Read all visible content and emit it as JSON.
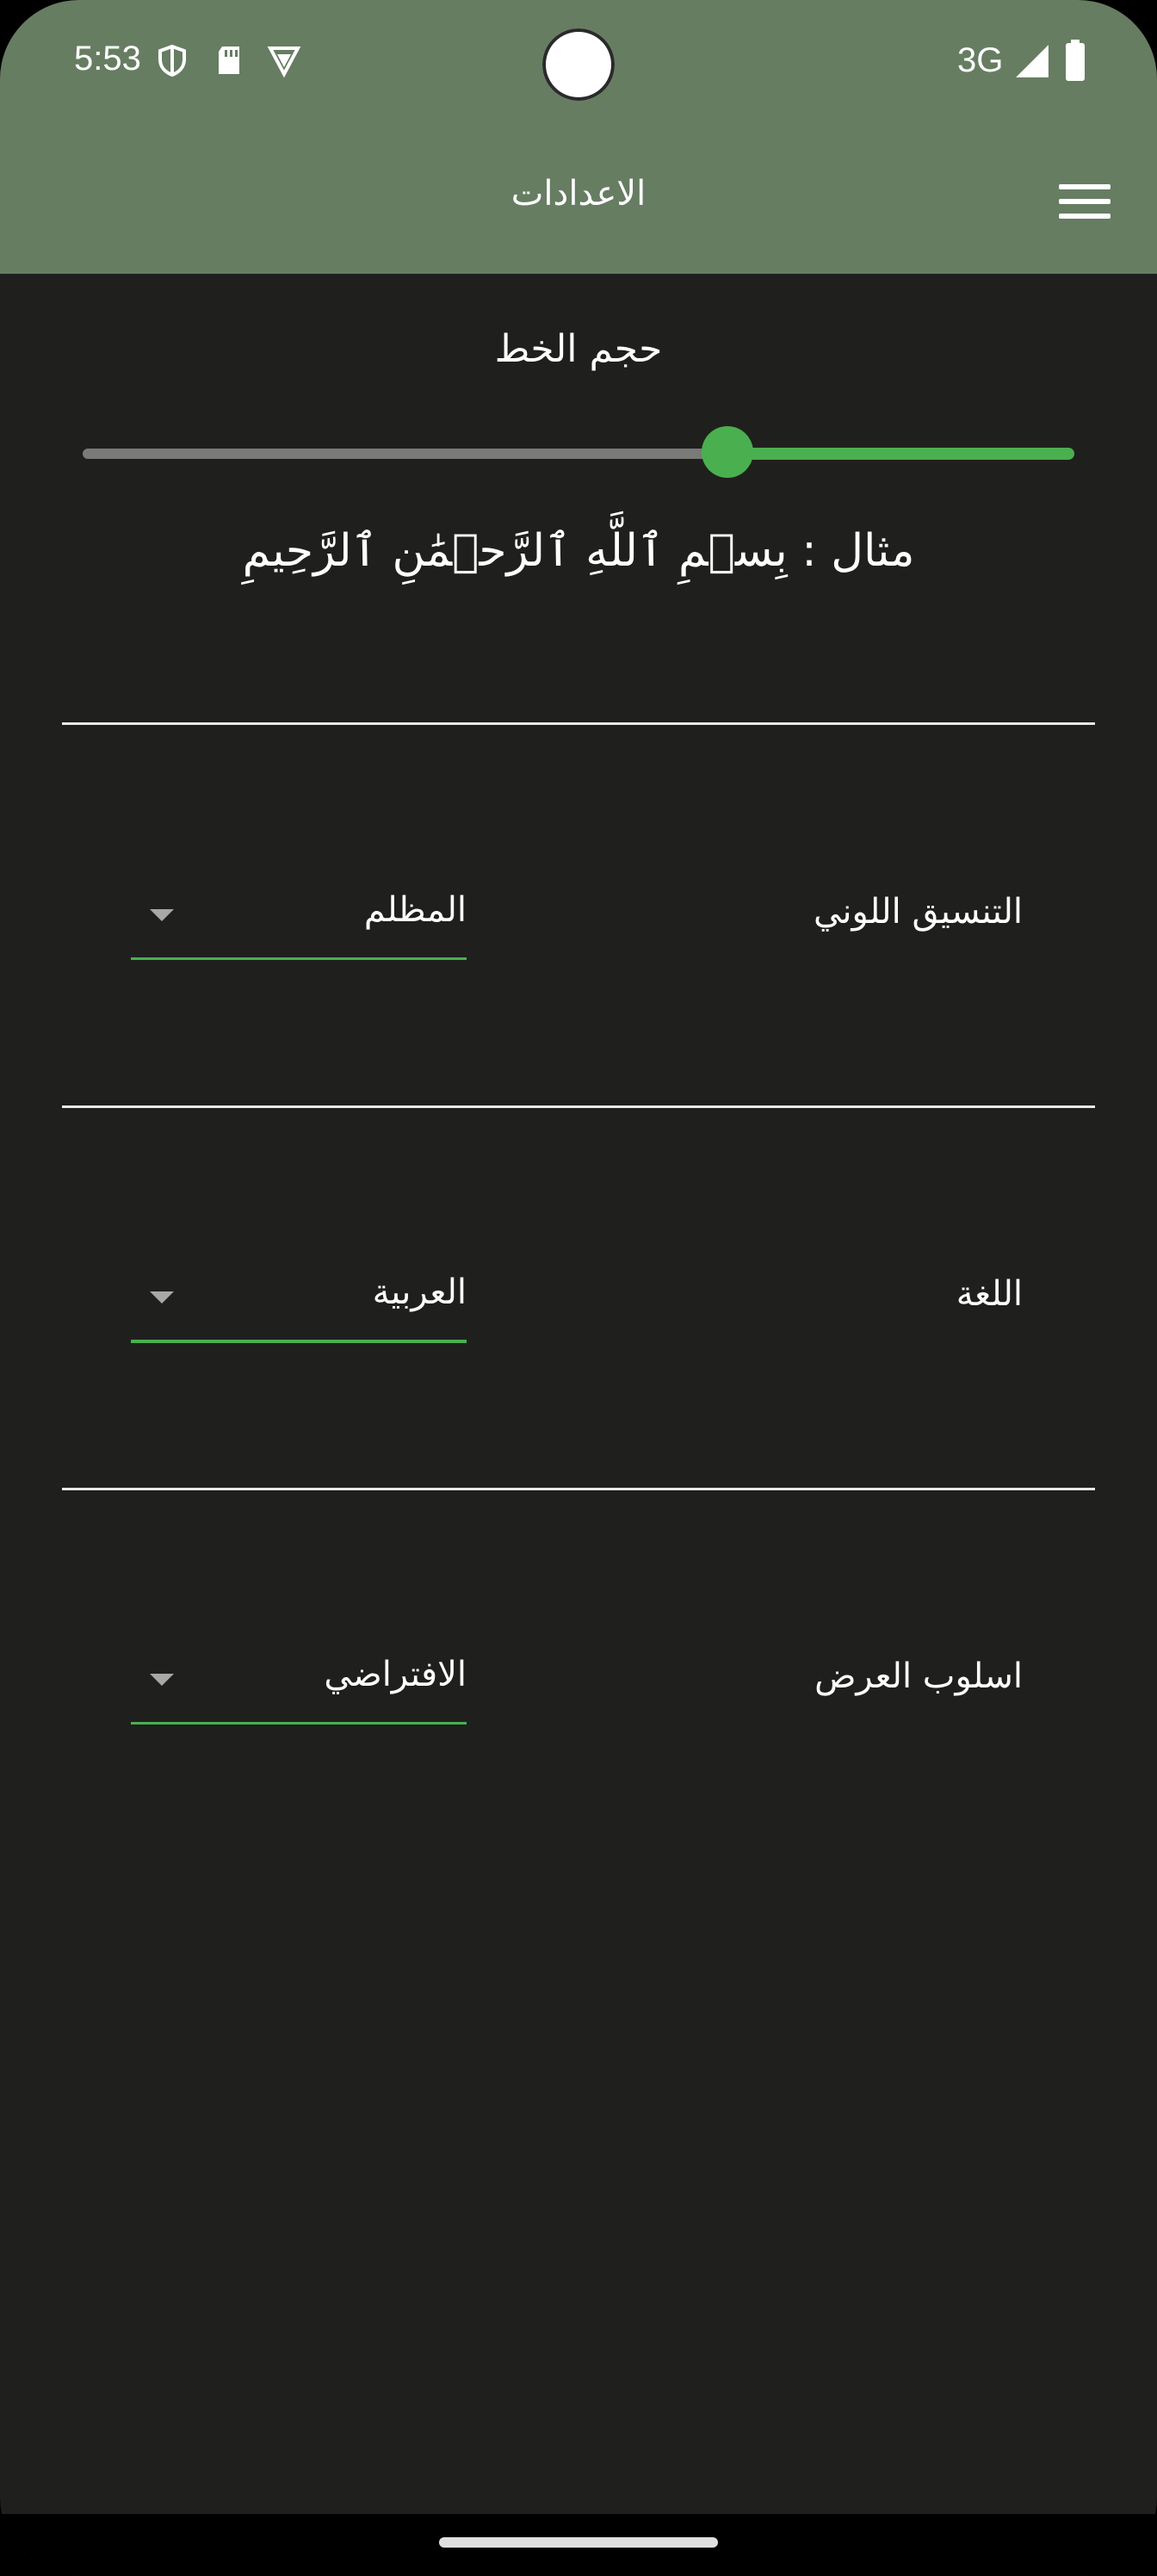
{
  "status_bar": {
    "time": "5:53",
    "network": "3G",
    "icons": [
      "shield-icon",
      "sd-card-icon",
      "vpn-icon",
      "signal-icon",
      "battery-icon"
    ]
  },
  "app_bar": {
    "title": "الاعدادات",
    "menu_icon": "hamburger-menu-icon",
    "color": "#667d62"
  },
  "font_size": {
    "title": "حجم الخط",
    "slider_value_fraction": 0.65,
    "example": "مثال : بِسۡمِ ٱللَّهِ ٱلرَّحۡمَٰنِ ٱلرَّحِيمِ"
  },
  "settings": [
    {
      "label": "التنسيق اللوني",
      "value": "المظلم"
    },
    {
      "label": "اللغة",
      "value": "العربية"
    },
    {
      "label": "اسلوب العرض",
      "value": "الافتراضي"
    }
  ],
  "colors": {
    "background": "#1f201e",
    "accent": "#4aaf4f"
  }
}
